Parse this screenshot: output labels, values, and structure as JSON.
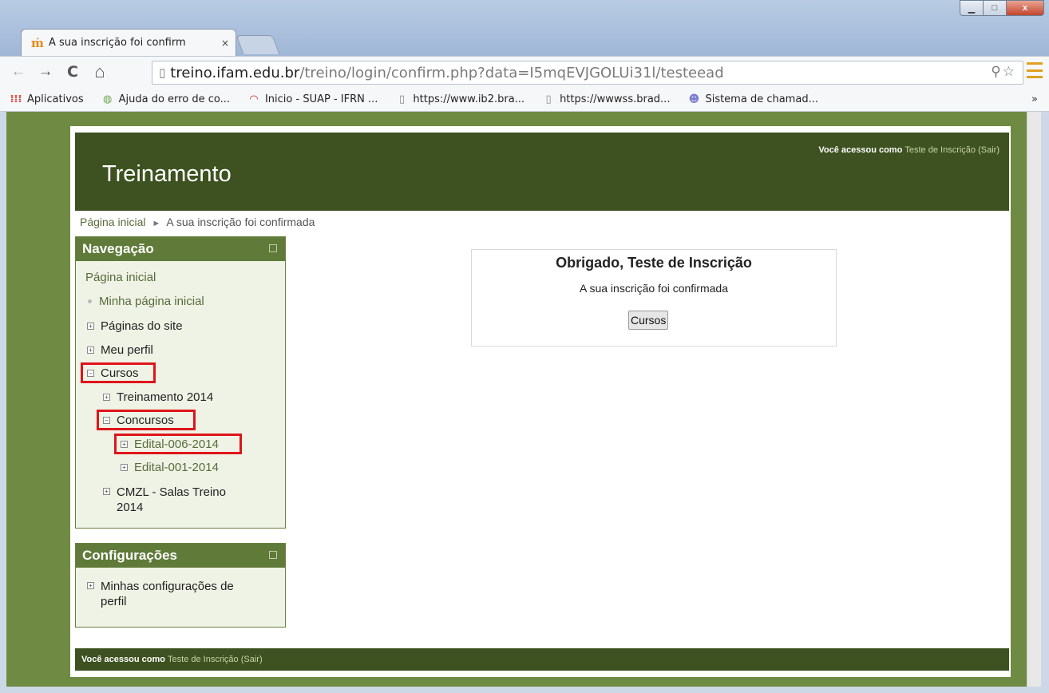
{
  "browser": {
    "tab_title": "A sua inscrição foi confirm",
    "tab_close": "×",
    "favicon": "moodle-favicon",
    "window_controls": {
      "minimize": "▁",
      "maximize": "□",
      "close": "x"
    },
    "nav": {
      "back": "←",
      "forward": "→",
      "reload": "C",
      "home": "⌂"
    },
    "url_host": "treino.ifam.edu.br",
    "url_path": "/treino/login/confirm.php?data=I5mqEVJGOLUi31l/testeead",
    "address_icons": "⚲☆",
    "bookmarks": [
      {
        "label": "Aplicativos",
        "icon": "apps-icon",
        "glyph": "⁞⁞⁞",
        "color": "#e8403a"
      },
      {
        "label": "Ajuda do erro de co...",
        "icon": "help-icon",
        "glyph": "◍",
        "color": "#6aa84f"
      },
      {
        "label": "Inicio - SUAP - IFRN ...",
        "icon": "suap-icon",
        "glyph": "◠",
        "color": "#d21f1f"
      },
      {
        "label": "https://www.ib2.bra...",
        "icon": "page-icon",
        "glyph": "▯",
        "color": "#888888"
      },
      {
        "label": "https://wwwss.brad...",
        "icon": "page-icon",
        "glyph": "▯",
        "color": "#888888"
      },
      {
        "label": "Sistema de chamad...",
        "icon": "support-icon",
        "glyph": "☻",
        "color": "#7b7bd0"
      }
    ],
    "bookmarks_more": "»"
  },
  "site": {
    "name": "Treinamento",
    "login_prefix": "Você acessou como",
    "user_name": "Teste de Inscrição",
    "logout_open": "(",
    "logout_label": "Sair",
    "logout_close": ")",
    "colors": {
      "header": "#3d5220",
      "block_header": "#5f7a39",
      "highlight": "#e0141b"
    }
  },
  "breadcrumb": {
    "home": "Página inicial",
    "separator": "►",
    "current": "A sua inscrição foi confirmada"
  },
  "navigation": {
    "title": "Navegação",
    "items": {
      "home": "Página inicial",
      "my_home": "Minha página inicial",
      "site_pages": "Páginas do site",
      "my_profile": "Meu perfil",
      "courses": "Cursos",
      "training_2014": "Treinamento 2014",
      "contests": "Concursos",
      "edital_006": "Edital-006-2014",
      "edital_001": "Edital-001-2014",
      "cmzl_line1": "CMZL - Salas Treino",
      "cmzl_line2": "2014"
    }
  },
  "settings": {
    "title": "Configurações",
    "item_line1": "Minhas configurações de",
    "item_line2": "perfil"
  },
  "confirmation": {
    "heading": "Obrigado, Teste de Inscrição",
    "message": "A sua inscrição foi confirmada",
    "button": "Cursos"
  },
  "tree_glyphs": {
    "expand": "+",
    "collapse": "−"
  }
}
